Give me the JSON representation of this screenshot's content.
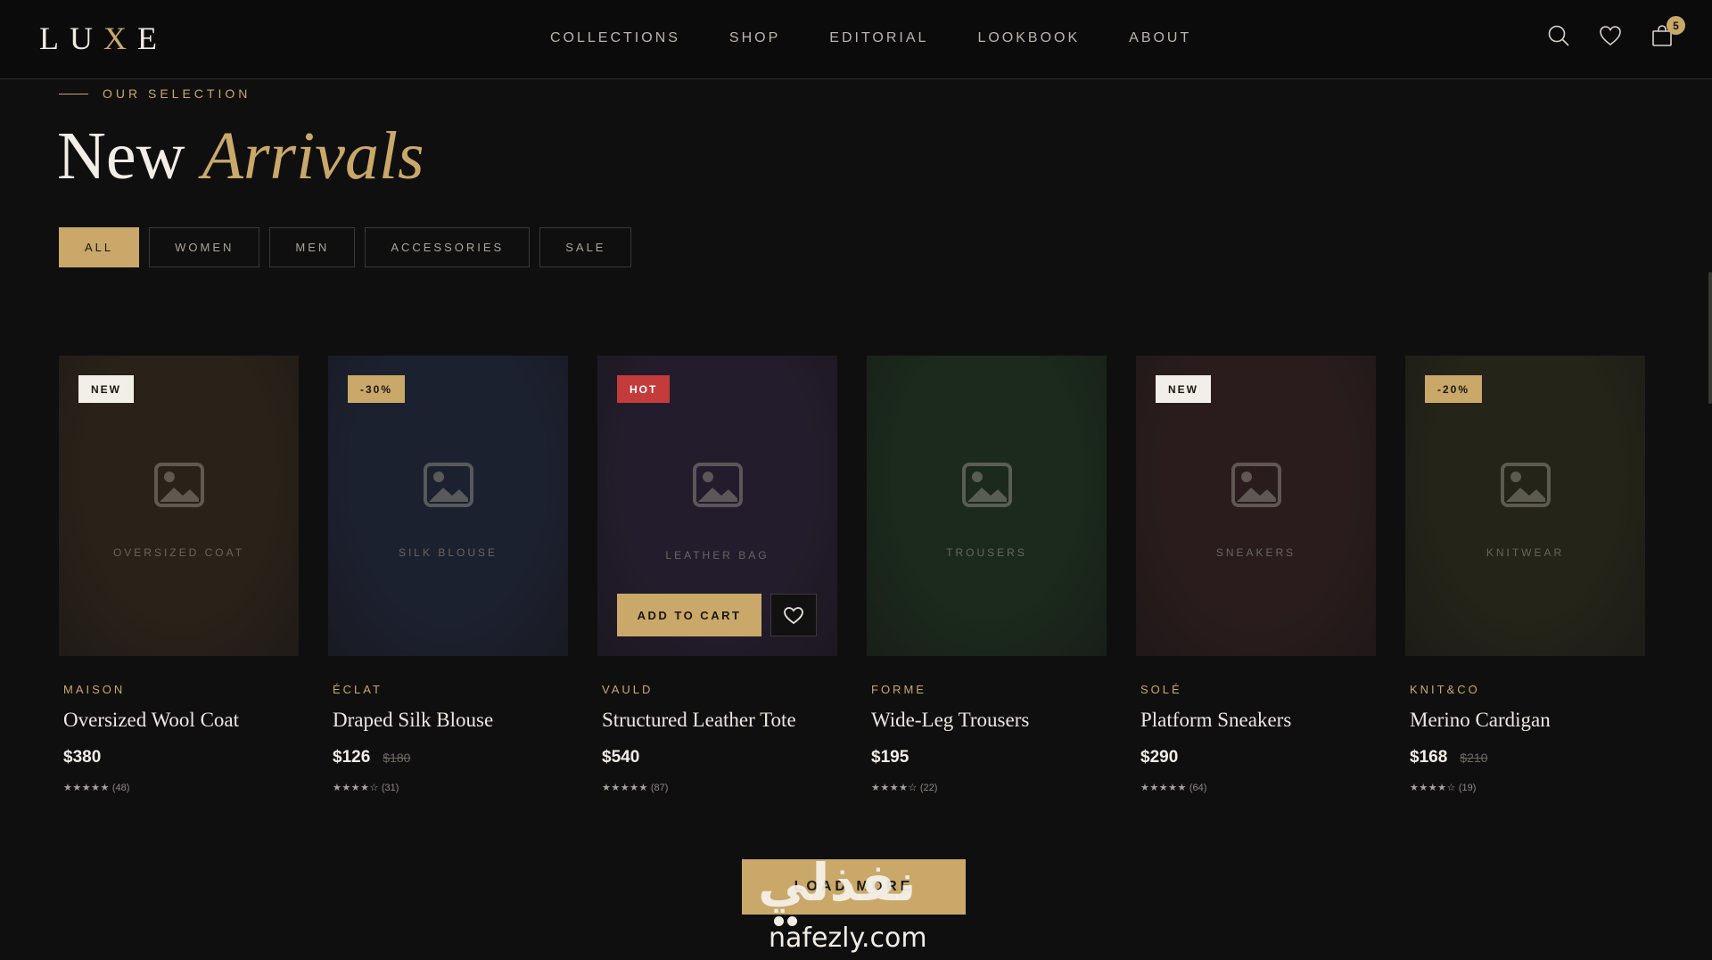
{
  "header": {
    "logo": {
      "pre": "LU",
      "accent": "X",
      "post": "E"
    },
    "nav": [
      "COLLECTIONS",
      "SHOP",
      "EDITORIAL",
      "LOOKBOOK",
      "ABOUT"
    ],
    "icons": [
      "search-icon",
      "heart-icon",
      "shopping-bag-icon"
    ],
    "cart_count": "5"
  },
  "section": {
    "eyebrow": "OUR SELECTION",
    "title_plain": "New",
    "title_accent": "Arrivals"
  },
  "filters": {
    "items": [
      "ALL",
      "WOMEN",
      "MEN",
      "ACCESSORIES",
      "SALE"
    ],
    "active": "ALL"
  },
  "products": [
    {
      "badge": "NEW",
      "thumb_label": "OVERSIZED COAT",
      "brand": "MAISON",
      "name": "Oversized Wool Coat",
      "price": "$380",
      "old_price": "",
      "stars": "★★★★★",
      "reviews": "(48)"
    },
    {
      "badge": "-30%",
      "thumb_label": "SILK BLOUSE",
      "brand": "ÉCLAT",
      "name": "Draped Silk Blouse",
      "price": "$126",
      "old_price": "$180",
      "stars": "★★★★☆",
      "reviews": "(31)"
    },
    {
      "badge": "HOT",
      "thumb_label": "LEATHER BAG",
      "brand": "VAULD",
      "name": "Structured Leather Tote",
      "price": "$540",
      "old_price": "",
      "stars": "★★★★★",
      "reviews": "(87)"
    },
    {
      "badge": "",
      "thumb_label": "TROUSERS",
      "brand": "FORME",
      "name": "Wide-Leg Trousers",
      "price": "$195",
      "old_price": "",
      "stars": "★★★★☆",
      "reviews": "(22)"
    },
    {
      "badge": "NEW",
      "thumb_label": "SNEAKERS",
      "brand": "SOLÉ",
      "name": "Platform Sneakers",
      "price": "$290",
      "old_price": "",
      "stars": "★★★★★",
      "reviews": "(64)"
    },
    {
      "badge": "-20%",
      "thumb_label": "KNITWEAR",
      "brand": "KNIT&CO",
      "name": "Merino Cardigan",
      "price": "$168",
      "old_price": "$210",
      "stars": "★★★★☆",
      "reviews": "(19)"
    }
  ],
  "hover_actions": {
    "add_to_cart": "ADD TO CART"
  },
  "load_more": "LOAD MORE",
  "watermark": {
    "arabic": "نفذلي",
    "latin": "nafezly.com"
  },
  "colors": {
    "accent": "#c9a86a",
    "badge_new_bg": "#f2efe8",
    "badge_hot_bg": "#c43b3b",
    "thumb_bgs": [
      "#2a2218",
      "#1c2130",
      "#231c2c",
      "#1b2a1c",
      "#2a1c1c",
      "#242418"
    ]
  }
}
